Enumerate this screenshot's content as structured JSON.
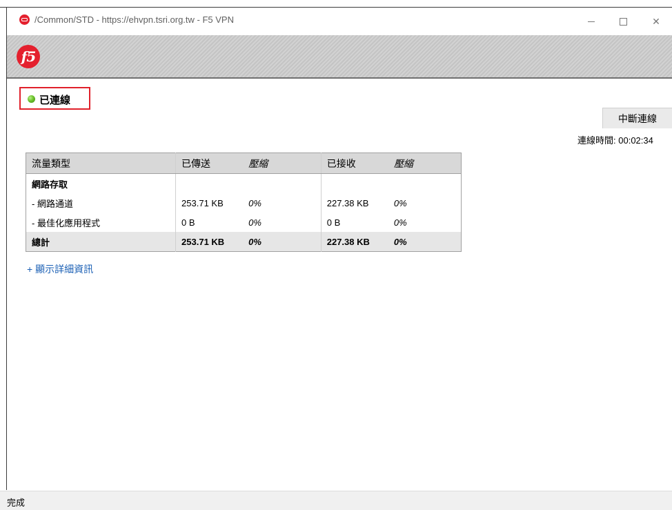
{
  "window": {
    "title": "/Common/STD - https://ehvpn.tsri.org.tw - F5 VPN",
    "minimize_glyph": "—",
    "close_glyph": "✕"
  },
  "banner": {
    "logo_text": "f5"
  },
  "connection": {
    "status": "已連線",
    "status_color": "#6cc22c",
    "disconnect_label": "中斷連線",
    "duration_label": "連線時間:",
    "duration_value": "00:02:34"
  },
  "table": {
    "headers": [
      "流量類型",
      "已傳送",
      "壓縮",
      "已接收",
      "壓縮"
    ],
    "rows": [
      {
        "type": "網路存取",
        "sent": "",
        "sent_comp": "",
        "recv": "",
        "recv_comp": ""
      },
      {
        "type": " - 網路通道",
        "sent": "253.71 KB",
        "sent_comp": "0%",
        "recv": "227.38 KB",
        "recv_comp": "0%"
      },
      {
        "type": " - 最佳化應用程式",
        "sent": "0 B",
        "sent_comp": "0%",
        "recv": "0 B",
        "recv_comp": "0%"
      }
    ],
    "total": {
      "type": "總計",
      "sent": "253.71 KB",
      "sent_comp": "0%",
      "recv": "227.38 KB",
      "recv_comp": "0%"
    }
  },
  "details_link": "+ 顯示詳細資訊",
  "statusbar": {
    "text": "完成"
  },
  "colors": {
    "accent_red": "#e4202e",
    "link": "#1a5fb4"
  }
}
